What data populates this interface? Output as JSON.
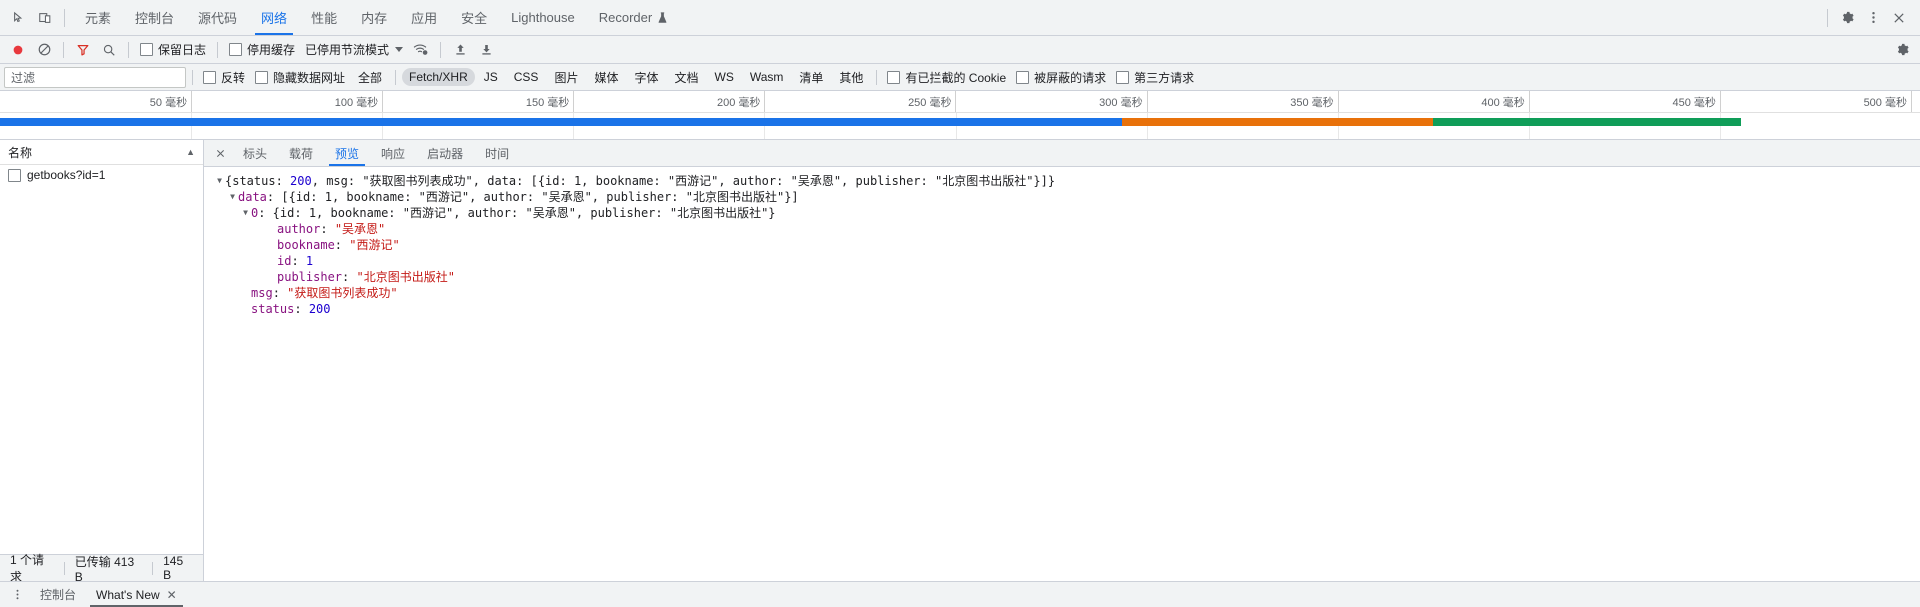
{
  "panel_tabs": {
    "items": [
      {
        "label": "元素",
        "active": false
      },
      {
        "label": "控制台",
        "active": false
      },
      {
        "label": "源代码",
        "active": false
      },
      {
        "label": "网络",
        "active": true
      },
      {
        "label": "性能",
        "active": false
      },
      {
        "label": "内存",
        "active": false
      },
      {
        "label": "应用",
        "active": false
      },
      {
        "label": "安全",
        "active": false
      },
      {
        "label": "Lighthouse",
        "active": false
      },
      {
        "label": "Recorder",
        "active": false,
        "icon": "flask-icon"
      }
    ],
    "left_icons": [
      "inspect-element-icon",
      "device-toolbar-icon"
    ],
    "right_icons": [
      "gear-icon",
      "more-options-icon",
      "close-icon"
    ]
  },
  "network_toolbar": {
    "record_label": "record-button",
    "clear_label": "clear-button",
    "filter_icon": "filter-icon",
    "search_icon": "search-icon",
    "preserve_log": {
      "label": "保留日志",
      "checked": false
    },
    "disable_cache": {
      "label": "停用缓存",
      "checked": false
    },
    "throttling": {
      "label": "已停用节流模式",
      "caret": "▼"
    },
    "wifi_icon": "network-conditions-icon",
    "import_icon": "import-har-icon",
    "export_icon": "export-har-icon",
    "settings_icon": "network-settings-icon"
  },
  "filter_bar": {
    "filter_placeholder": "过滤",
    "filter_value": "",
    "invert": {
      "label": "反转",
      "checked": false
    },
    "hide_data_urls": {
      "label": "隐藏数据网址",
      "checked": false
    },
    "types": [
      {
        "label": "全部",
        "selected": false
      },
      {
        "label": "Fetch/XHR",
        "selected": true
      },
      {
        "label": "JS",
        "selected": false
      },
      {
        "label": "CSS",
        "selected": false
      },
      {
        "label": "图片",
        "selected": false
      },
      {
        "label": "媒体",
        "selected": false
      },
      {
        "label": "字体",
        "selected": false
      },
      {
        "label": "文档",
        "selected": false
      },
      {
        "label": "WS",
        "selected": false
      },
      {
        "label": "Wasm",
        "selected": false
      },
      {
        "label": "清单",
        "selected": false
      },
      {
        "label": "其他",
        "selected": false
      }
    ],
    "blocked_cookies": {
      "label": "有已拦截的 Cookie",
      "checked": false
    },
    "blocked_requests": {
      "label": "被屏蔽的请求",
      "checked": false
    },
    "third_party": {
      "label": "第三方请求",
      "checked": false
    }
  },
  "overview": {
    "ticks": [
      "50 毫秒",
      "100 毫秒",
      "150 毫秒",
      "200 毫秒",
      "250 毫秒",
      "300 毫秒",
      "350 毫秒",
      "400 毫秒",
      "450 毫秒",
      "500 毫秒"
    ],
    "bands": [
      {
        "name": "loading-band-blue",
        "color": "#1a73e8",
        "left_pct": 0.0,
        "width_pct": 58.7
      },
      {
        "name": "waiting-band-orange",
        "color": "#e8710a",
        "left_pct": 58.7,
        "width_pct": 16.3
      },
      {
        "name": "download-band-green",
        "color": "#0f9d58",
        "left_pct": 75.0,
        "width_pct": 16.1
      }
    ]
  },
  "requests": {
    "column_header": "名称",
    "sort_indicator": "▲",
    "rows": [
      {
        "name": "getbooks?id=1",
        "icon": "document-icon"
      }
    ],
    "status_bar": {
      "request_count": "1 个请求",
      "transferred": "已传输 413 B",
      "resources": "145 B"
    }
  },
  "detail": {
    "close_icon": "close-icon",
    "tabs": [
      {
        "label": "标头",
        "active": false
      },
      {
        "label": "载荷",
        "active": false
      },
      {
        "label": "预览",
        "active": true
      },
      {
        "label": "响应",
        "active": false
      },
      {
        "label": "启动器",
        "active": false
      },
      {
        "label": "时间",
        "active": false
      }
    ],
    "preview_lines": [
      {
        "indent": 0,
        "triangle": "▼",
        "tokens": [
          {
            "t": "{",
            "c": "punct"
          },
          {
            "t": "status",
            "c": "k-name"
          },
          {
            "t": ": ",
            "c": "punct"
          },
          {
            "t": "200",
            "c": "v-num"
          },
          {
            "t": ", ",
            "c": "punct"
          },
          {
            "t": "msg",
            "c": "k-name"
          },
          {
            "t": ": ",
            "c": "punct"
          },
          {
            "t": "\"获取图书列表成功\"",
            "c": "k-name"
          },
          {
            "t": ", ",
            "c": "punct"
          },
          {
            "t": "data",
            "c": "k-name"
          },
          {
            "t": ": [{",
            "c": "punct"
          },
          {
            "t": "id",
            "c": "k-name"
          },
          {
            "t": ": 1, ",
            "c": "punct"
          },
          {
            "t": "bookname",
            "c": "k-name"
          },
          {
            "t": ": \"西游记\", ",
            "c": "punct"
          },
          {
            "t": "author",
            "c": "k-name"
          },
          {
            "t": ": \"吴承恩\", ",
            "c": "punct"
          },
          {
            "t": "publisher",
            "c": "k-name"
          },
          {
            "t": ": \"北京图书出版社\"}]}",
            "c": "punct"
          }
        ]
      },
      {
        "indent": 1,
        "triangle": "▼",
        "tokens": [
          {
            "t": "data",
            "c": "k-prop"
          },
          {
            "t": ": [{",
            "c": "punct"
          },
          {
            "t": "id",
            "c": "k-name"
          },
          {
            "t": ": 1, ",
            "c": "punct"
          },
          {
            "t": "bookname",
            "c": "k-name"
          },
          {
            "t": ": \"西游记\", ",
            "c": "punct"
          },
          {
            "t": "author",
            "c": "k-name"
          },
          {
            "t": ": \"吴承恩\", ",
            "c": "punct"
          },
          {
            "t": "publisher",
            "c": "k-name"
          },
          {
            "t": ": \"北京图书出版社\"}]",
            "c": "punct"
          }
        ]
      },
      {
        "indent": 2,
        "triangle": "▼",
        "tokens": [
          {
            "t": "0",
            "c": "k-prop"
          },
          {
            "t": ": {",
            "c": "punct"
          },
          {
            "t": "id",
            "c": "k-name"
          },
          {
            "t": ": 1, ",
            "c": "punct"
          },
          {
            "t": "bookname",
            "c": "k-name"
          },
          {
            "t": ": \"西游记\", ",
            "c": "punct"
          },
          {
            "t": "author",
            "c": "k-name"
          },
          {
            "t": ": \"吴承恩\", ",
            "c": "punct"
          },
          {
            "t": "publisher",
            "c": "k-name"
          },
          {
            "t": ": \"北京图书出版社\"}",
            "c": "punct"
          }
        ]
      },
      {
        "indent": 4,
        "triangle": "",
        "tokens": [
          {
            "t": "author",
            "c": "k-prop"
          },
          {
            "t": ": ",
            "c": "punct"
          },
          {
            "t": "\"吴承恩\"",
            "c": "v-str"
          }
        ]
      },
      {
        "indent": 4,
        "triangle": "",
        "tokens": [
          {
            "t": "bookname",
            "c": "k-prop"
          },
          {
            "t": ": ",
            "c": "punct"
          },
          {
            "t": "\"西游记\"",
            "c": "v-str"
          }
        ]
      },
      {
        "indent": 4,
        "triangle": "",
        "tokens": [
          {
            "t": "id",
            "c": "k-prop"
          },
          {
            "t": ": ",
            "c": "punct"
          },
          {
            "t": "1",
            "c": "v-num"
          }
        ]
      },
      {
        "indent": 4,
        "triangle": "",
        "tokens": [
          {
            "t": "publisher",
            "c": "k-prop"
          },
          {
            "t": ": ",
            "c": "punct"
          },
          {
            "t": "\"北京图书出版社\"",
            "c": "v-str"
          }
        ]
      },
      {
        "indent": 2,
        "triangle": "",
        "tokens": [
          {
            "t": "msg",
            "c": "k-prop"
          },
          {
            "t": ": ",
            "c": "punct"
          },
          {
            "t": "\"获取图书列表成功\"",
            "c": "v-str"
          }
        ]
      },
      {
        "indent": 2,
        "triangle": "",
        "tokens": [
          {
            "t": "status",
            "c": "k-prop"
          },
          {
            "t": ": ",
            "c": "punct"
          },
          {
            "t": "200",
            "c": "v-num"
          }
        ]
      }
    ]
  },
  "drawer": {
    "menu_icon": "drawer-menu-icon",
    "tabs": [
      {
        "label": "控制台",
        "active": false,
        "closable": false
      },
      {
        "label": "What's New",
        "active": true,
        "closable": true
      }
    ],
    "close_glyph": "✕"
  }
}
